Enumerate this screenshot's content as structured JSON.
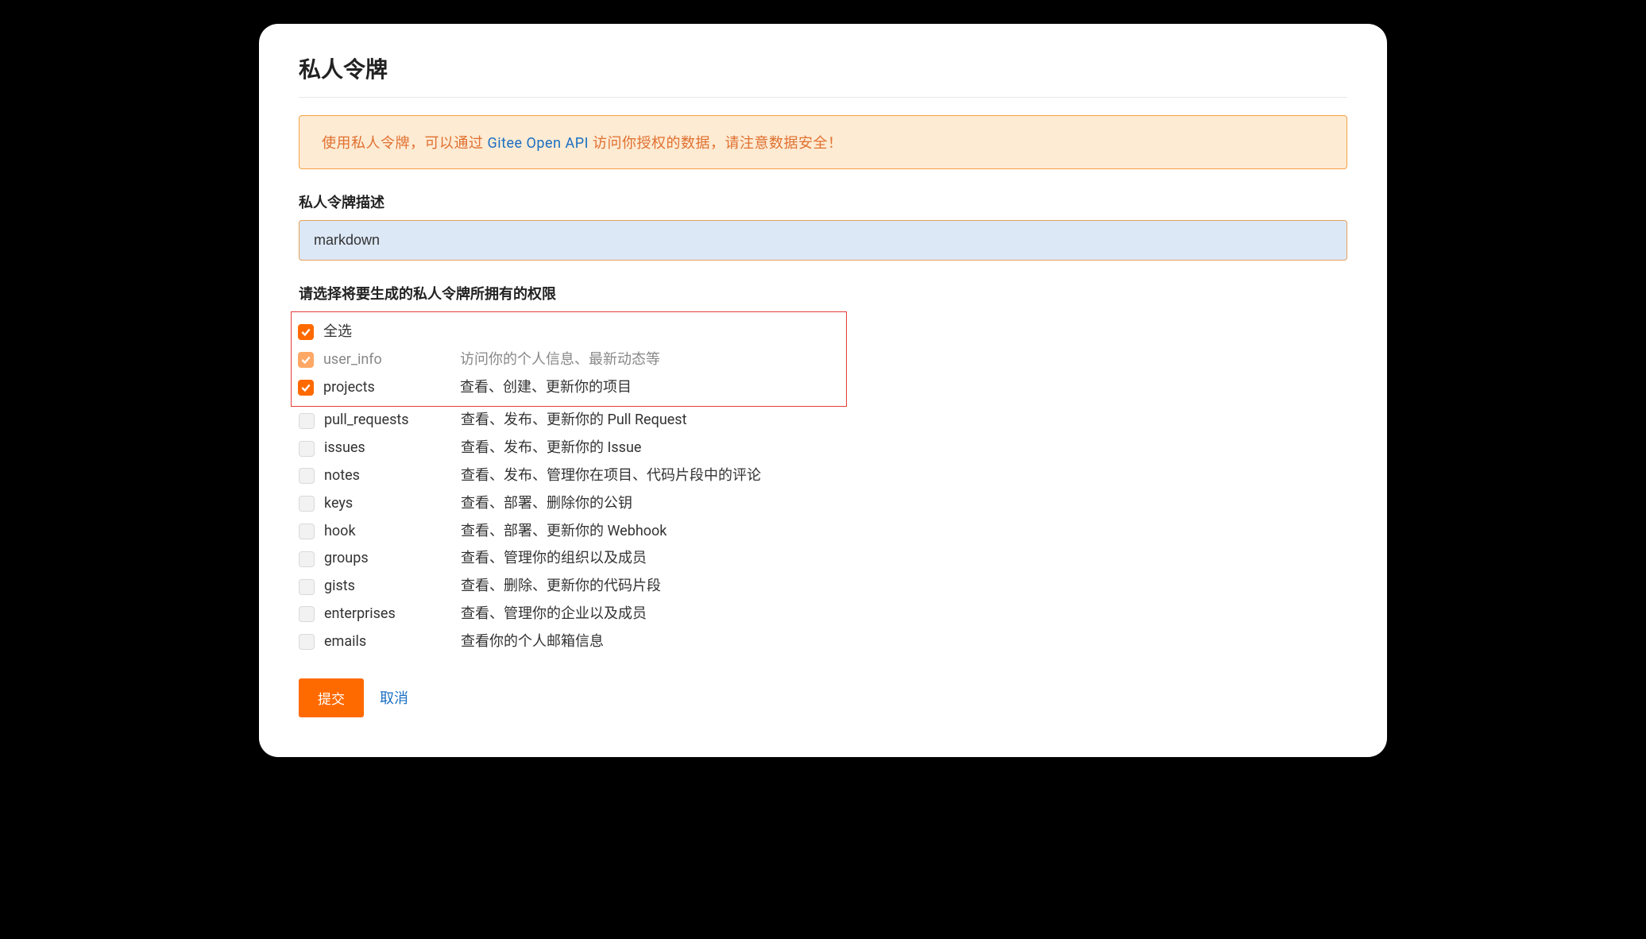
{
  "pageTitle": "私人令牌",
  "noticePre": "使用私人令牌，可以通过 ",
  "noticeLink": "Gitee Open API",
  "noticePost": " 访问你授权的数据，请注意数据安全！",
  "descLabel": "私人令牌描述",
  "descValue": "markdown",
  "permLabel": "请选择将要生成的私人令牌所拥有的权限",
  "selectAll": "全选",
  "perms": [
    {
      "key": "user_info",
      "desc": "访问你的个人信息、最新动态等",
      "checked": true,
      "muted": true
    },
    {
      "key": "projects",
      "desc": "查看、创建、更新你的项目",
      "checked": true,
      "muted": false
    },
    {
      "key": "pull_requests",
      "desc": "查看、发布、更新你的 Pull Request",
      "checked": false,
      "muted": false
    },
    {
      "key": "issues",
      "desc": "查看、发布、更新你的 Issue",
      "checked": false,
      "muted": false
    },
    {
      "key": "notes",
      "desc": "查看、发布、管理你在项目、代码片段中的评论",
      "checked": false,
      "muted": false
    },
    {
      "key": "keys",
      "desc": "查看、部署、删除你的公钥",
      "checked": false,
      "muted": false
    },
    {
      "key": "hook",
      "desc": "查看、部署、更新你的 Webhook",
      "checked": false,
      "muted": false
    },
    {
      "key": "groups",
      "desc": "查看、管理你的组织以及成员",
      "checked": false,
      "muted": false
    },
    {
      "key": "gists",
      "desc": "查看、删除、更新你的代码片段",
      "checked": false,
      "muted": false
    },
    {
      "key": "enterprises",
      "desc": "查看、管理你的企业以及成员",
      "checked": false,
      "muted": false
    },
    {
      "key": "emails",
      "desc": "查看你的个人邮箱信息",
      "checked": false,
      "muted": false
    }
  ],
  "submitLabel": "提交",
  "cancelLabel": "取消"
}
